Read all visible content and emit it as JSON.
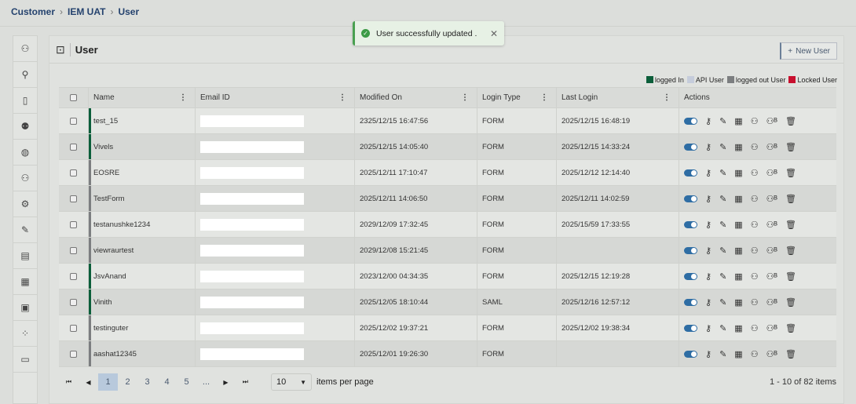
{
  "breadcrumb": [
    "Customer",
    "IEM UAT",
    "User"
  ],
  "toast": {
    "message": "User successfully updated .",
    "icon": "check-circle-icon"
  },
  "page": {
    "title": "User",
    "new_button": "New User"
  },
  "legend": [
    {
      "label": "logged In",
      "color": "#0b5e3a"
    },
    {
      "label": "API User",
      "color": "#c5ccdb"
    },
    {
      "label": "logged out User",
      "color": "#7c7e80"
    },
    {
      "label": "Locked User",
      "color": "#c8102e"
    }
  ],
  "columns": [
    "Name",
    "Email ID",
    "Modified On",
    "Login Type",
    "Last Login",
    "Actions"
  ],
  "rows": [
    {
      "name": "test_15",
      "modified": "2325/12/15 16:47:56",
      "login_type": "FORM",
      "last_login": "2025/12/15 16:48:19",
      "status": "logged In"
    },
    {
      "name": "Vivels",
      "modified": "2025/12/15 14:05:40",
      "login_type": "FORM",
      "last_login": "2025/12/15 14:33:24",
      "status": "logged In"
    },
    {
      "name": "EOSRE",
      "modified": "2025/12/11 17:10:47",
      "login_type": "FORM",
      "last_login": "2025/12/12 12:14:40",
      "status": "logged out User"
    },
    {
      "name": "TestForm",
      "modified": "2025/12/11 14:06:50",
      "login_type": "FORM",
      "last_login": "2025/12/11 14:02:59",
      "status": "logged out User"
    },
    {
      "name": "testanushke1234",
      "modified": "2029/12/09 17:32:45",
      "login_type": "FORM",
      "last_login": "2025/15/59 17:33:55",
      "status": "logged out User"
    },
    {
      "name": "viewraurtest",
      "modified": "2029/12/08 15:21:45",
      "login_type": "FORM",
      "last_login": "",
      "status": "logged out User"
    },
    {
      "name": "JsvAnand",
      "modified": "2023/12/00 04:34:35",
      "login_type": "FORM",
      "last_login": "2025/12/15 12:19:28",
      "status": "logged In"
    },
    {
      "name": "Vinith",
      "modified": "2025/12/05 18:10:44",
      "login_type": "SAML",
      "last_login": "2025/12/16 12:57:12",
      "status": "logged In"
    },
    {
      "name": "testinguter",
      "modified": "2025/12/02 19:37:21",
      "login_type": "FORM",
      "last_login": "2025/12/02 19:38:34",
      "status": "logged out User"
    },
    {
      "name": "aashat12345",
      "modified": "2025/12/01 19:26:30",
      "login_type": "FORM",
      "last_login": "",
      "status": "logged out User"
    }
  ],
  "pagination": {
    "pages": [
      "1",
      "2",
      "3",
      "4",
      "5",
      "..."
    ],
    "current": "1",
    "page_size": "10",
    "items_per_page_label": "items per page",
    "summary": "1 - 10 of 82 items"
  }
}
